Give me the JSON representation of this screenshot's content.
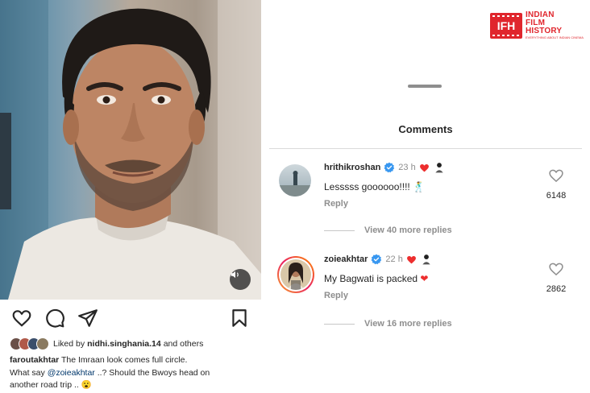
{
  "post": {
    "liked_by_prefix": "Liked by ",
    "liked_by_user": "nidhi.singhania.14",
    "liked_by_suffix": " and others",
    "caption_user": "faroutakhtar",
    "caption_part1": " The Imraan look comes full circle.",
    "caption_part2": "What say ",
    "caption_mention": "@zoieakhtar",
    "caption_part3": " ..? Should the Bwoys head on",
    "caption_part4": "another road trip .. ",
    "caption_emoji": "😮"
  },
  "logo": {
    "mark": "IFH",
    "line1": "INDIAN",
    "line2": "FILM",
    "line3": "HISTORY",
    "tagline": "EVERYTHING ABOUT INDIAN CINEMA"
  },
  "sheet": {
    "title": "Comments"
  },
  "comments": [
    {
      "username": "hrithikroshan",
      "time": "23 h",
      "text": "Lesssss goooooo!!!! ",
      "text_emoji": "🕺",
      "reply_label": "Reply",
      "likes": "6148",
      "more_replies": "View 40 more replies"
    },
    {
      "username": "zoieakhtar",
      "time": "22 h",
      "text": "My Bagwati is packed ",
      "text_emoji": "❤",
      "reply_label": "Reply",
      "likes": "2862",
      "more_replies": "View 16 more replies"
    }
  ],
  "colors": {
    "verified": "#3897f0",
    "heart": "#ed2e2e",
    "brand": "#e0262d",
    "link": "#00376b"
  },
  "icons": [
    "heart-icon",
    "comment-icon",
    "share-icon",
    "bookmark-icon",
    "audio-icon",
    "verified-icon",
    "heart-outline-icon"
  ]
}
